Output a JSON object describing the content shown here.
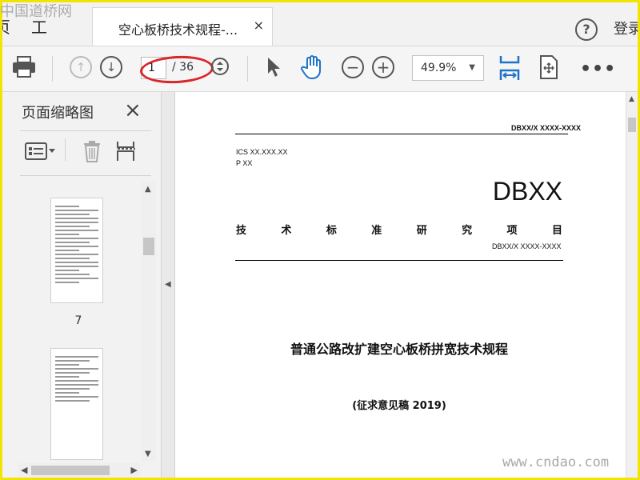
{
  "watermark": {
    "top_left": "中国道桥网",
    "bottom_right": "www.cndao.com"
  },
  "tabbar": {
    "home_tab_clip": "页",
    "tools_tab": "工具",
    "doc_tab_title": "空心板桥技术规程-...",
    "close_symbol": "×",
    "help_symbol": "?",
    "login": "登录"
  },
  "toolbar": {
    "page_current": "1",
    "page_total": "/ 36",
    "zoom": "49.9%",
    "more": "•••"
  },
  "sidebar": {
    "title": "页面缩略图",
    "close_symbol": "×",
    "thumbnails": [
      {
        "page_number": "7"
      },
      {
        "page_number": ""
      }
    ]
  },
  "document": {
    "header_code": "DBXX/X  XXXX-XXXX",
    "ics": "ICS XX.XXX.XX",
    "p": "P XX",
    "big_code": "DBXX",
    "tech_chars": [
      "技",
      "术",
      "标",
      "准",
      "研",
      "究",
      "项",
      "目"
    ],
    "code_line": "DBXX/X XXXX-XXXX",
    "main_title": "普通公路改扩建空心板桥拼宽技术规程",
    "subtitle": "(征求意见稿 2019)"
  }
}
